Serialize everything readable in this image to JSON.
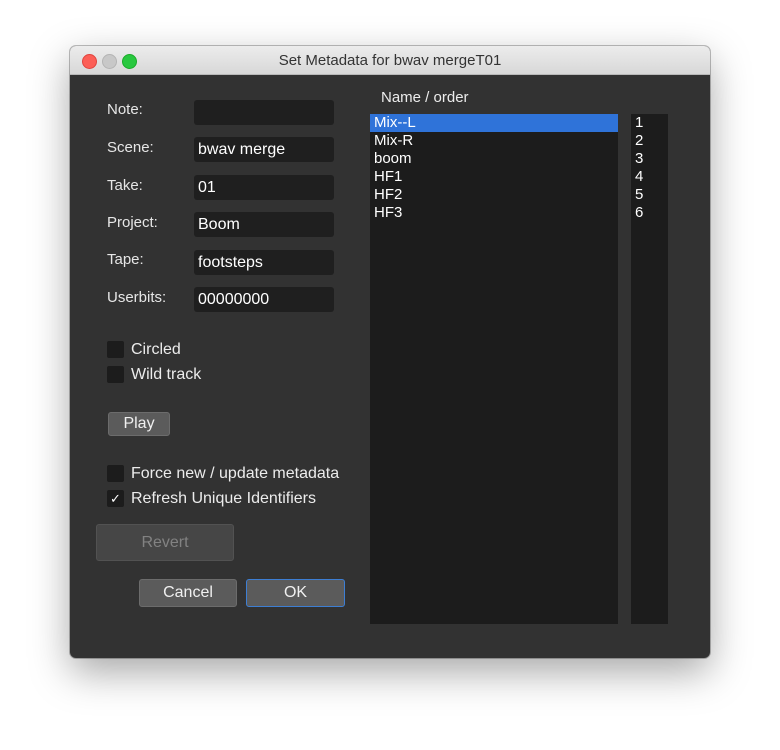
{
  "window": {
    "title": "Set Metadata for bwav mergeT01"
  },
  "form": {
    "note_label": "Note:",
    "note_value": "",
    "scene_label": "Scene:",
    "scene_value": "bwav merge",
    "take_label": "Take:",
    "take_value": "01",
    "project_label": "Project:",
    "project_value": "Boom",
    "tape_label": "Tape:",
    "tape_value": "footsteps",
    "userbits_label": "Userbits:",
    "userbits_value": "00000000"
  },
  "checkboxes": {
    "circled": {
      "label": "Circled",
      "checked": false
    },
    "wild_track": {
      "label": "Wild track",
      "checked": false
    },
    "force_new": {
      "label": "Force new / update metadata",
      "checked": false
    },
    "refresh_ids": {
      "label": "Refresh Unique Identifiers",
      "checked": true,
      "mark": "✓"
    }
  },
  "buttons": {
    "play": "Play",
    "revert": "Revert",
    "cancel": "Cancel",
    "ok": "OK"
  },
  "tracks": {
    "header": "Name / order",
    "items": [
      {
        "name": "Mix--L",
        "order": "1",
        "selected": true
      },
      {
        "name": "Mix-R",
        "order": "2"
      },
      {
        "name": "boom",
        "order": "3"
      },
      {
        "name": "HF1",
        "order": "4"
      },
      {
        "name": "HF2",
        "order": "5"
      },
      {
        "name": "HF3",
        "order": "6"
      }
    ]
  },
  "colors": {
    "selection": "#2f73d9",
    "window_bg": "#323232",
    "field_bg": "#1f1f1f",
    "close": "#fc5f57",
    "maximize": "#29c840"
  }
}
